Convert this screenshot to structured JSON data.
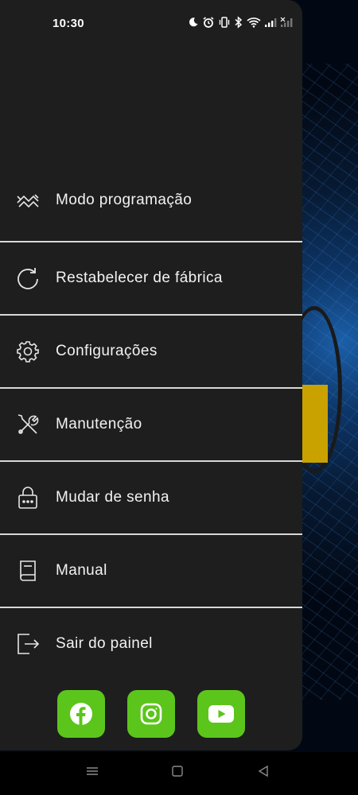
{
  "status_bar": {
    "time": "10:30"
  },
  "menu": {
    "items": [
      {
        "id": "programming",
        "label": "Modo programação",
        "icon": "programming-mode-icon"
      },
      {
        "id": "factory-reset",
        "label": "Restabelecer de fábrica",
        "icon": "refresh-icon"
      },
      {
        "id": "settings",
        "label": "Configurações",
        "icon": "gear-icon"
      },
      {
        "id": "maintenance",
        "label": "Manutenção",
        "icon": "tools-icon"
      },
      {
        "id": "change-password",
        "label": "Mudar de senha",
        "icon": "padlock-icon"
      },
      {
        "id": "manual",
        "label": "Manual",
        "icon": "book-icon"
      },
      {
        "id": "logout",
        "label": "Sair do painel",
        "icon": "exit-icon"
      }
    ]
  },
  "social": {
    "items": [
      "facebook-icon",
      "instagram-icon",
      "youtube-icon"
    ],
    "color": "#5cc51b"
  },
  "colors": {
    "drawer_bg": "#1e1e1e",
    "divider": "#d8d8d8",
    "accent": "#5cc51b"
  }
}
